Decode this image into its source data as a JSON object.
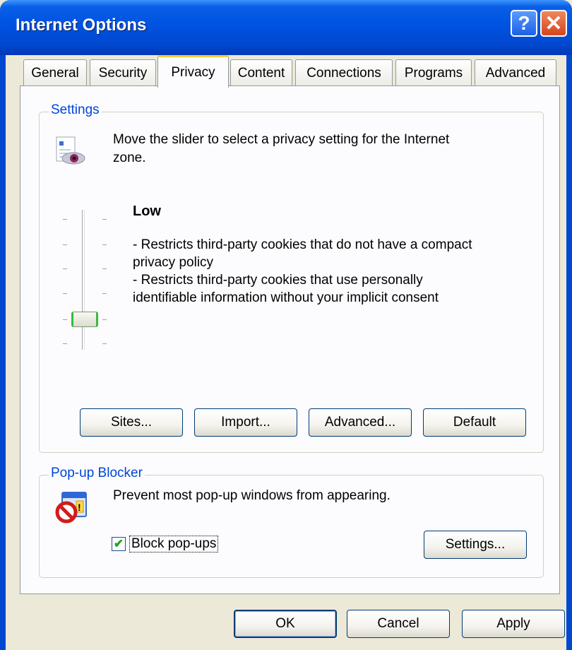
{
  "window": {
    "title": "Internet Options",
    "help_glyph": "?",
    "close_glyph": "✕"
  },
  "tabs": [
    "General",
    "Security",
    "Privacy",
    "Content",
    "Connections",
    "Programs",
    "Advanced"
  ],
  "active_tab": "Privacy",
  "settings": {
    "legend": "Settings",
    "instruction_line1": "Move the slider to select a privacy setting for the Internet",
    "instruction_line2": "zone.",
    "level_title": "Low",
    "desc_lines": [
      "- Restricts third-party cookies that do not have a compact",
      "privacy policy",
      "- Restricts third-party cookies that use personally",
      "identifiable information without your implicit consent"
    ],
    "slider_level": "Low",
    "buttons": {
      "sites": "Sites...",
      "import": "Import...",
      "advanced": "Advanced...",
      "default": "Default"
    }
  },
  "popup": {
    "legend": "Pop-up Blocker",
    "instruction": "Prevent most pop-up windows from appearing.",
    "checkbox_label": "Block pop-ups",
    "checkbox_checked": true,
    "checkmark": "✔",
    "settings_button": "Settings..."
  },
  "footer": {
    "ok": "OK",
    "cancel": "Cancel",
    "apply": "Apply"
  }
}
